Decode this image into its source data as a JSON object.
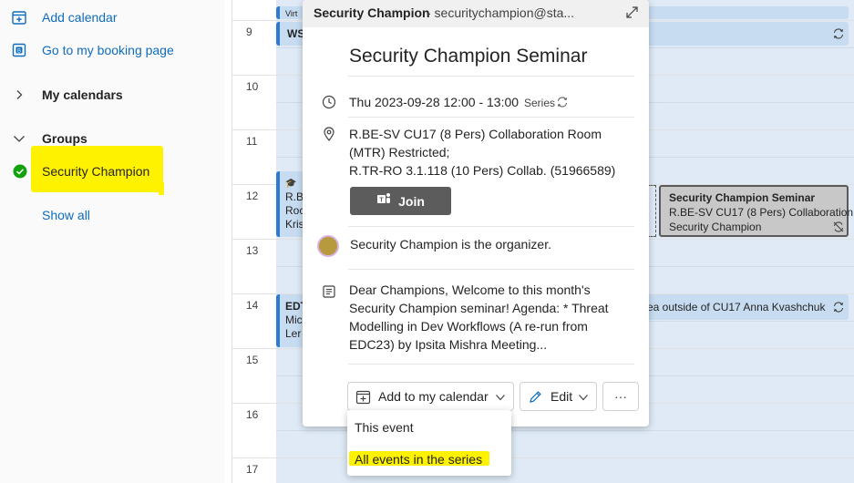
{
  "sidebar": {
    "add_calendar": "Add calendar",
    "booking_page": "Go to my booking page",
    "my_calendars": "My calendars",
    "groups": "Groups",
    "group_item": "Security Champion",
    "show_all": "Show all"
  },
  "calendar": {
    "hours": [
      "9",
      "10",
      "11",
      "12",
      "13",
      "14",
      "15",
      "16",
      "17"
    ],
    "events": {
      "top_bar": "Virt",
      "ws": "WS",
      "left12_lines": [
        "R.B",
        "Roc",
        "Kris"
      ],
      "edt_lines": [
        "EDT",
        "Mic",
        "Ler"
      ],
      "right14_text": "ea outside of CU17  Anna Kvashchuk"
    },
    "selected_event": {
      "title": "Security Champion Seminar",
      "location": "R.BE-SV CU17 (8 Pers) Collaboration",
      "organizer": "Security Champion"
    }
  },
  "popup": {
    "header_name": "Security Champion",
    "header_email": " - securitychampion@sta...",
    "title": "Security Champion Seminar",
    "datetime": "Thu 2023-09-28 12:00 - 13:00",
    "series_label": "Series",
    "location_lines": [
      "R.BE-SV CU17 (8 Pers) Collaboration Room",
      "(MTR) Restricted;",
      "R.TR-RO 3.1.118 (10 Pers) Collab. (51966589)"
    ],
    "join_label": "Join",
    "organizer_text": "Security Champion is the organizer.",
    "description_lines": [
      "Dear Champions, Welcome to this month's",
      "Security Champion seminar! Agenda: * Threat",
      "Modelling in Dev Workflows (A re-run from",
      "EDC23) by Ipsita Mishra Meeting..."
    ],
    "add_to_calendar_label": "Add to my calendar",
    "edit_label": "Edit",
    "more_label": "···"
  },
  "dropdown": {
    "items": [
      "This event",
      "All events in the series"
    ]
  },
  "colors": {
    "accent": "#0f6cbd",
    "highlight": "#fff200",
    "event_bg": "#c7dcf1",
    "event_border": "#2c7bd3",
    "status_green": "#13a10e",
    "join_bg": "#5c5c5c"
  },
  "icons": {
    "add_calendar": "calendar-add-icon",
    "booking": "booking-icon",
    "clock": "clock-icon",
    "location": "location-pin-icon",
    "teams": "teams-icon",
    "description": "notes-icon",
    "recurrence": "recurrence-icon",
    "expand": "expand-icon"
  }
}
